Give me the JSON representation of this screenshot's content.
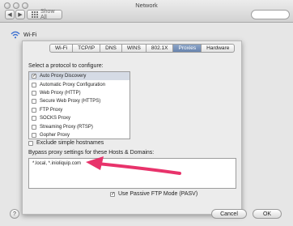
{
  "window": {
    "title": "Network",
    "show_all": "Show All",
    "back": "◀",
    "forward": "▶"
  },
  "network": {
    "service": "Wi-Fi"
  },
  "tabs": [
    {
      "label": "Wi-Fi",
      "active": false
    },
    {
      "label": "TCP/IP",
      "active": false
    },
    {
      "label": "DNS",
      "active": false
    },
    {
      "label": "WINS",
      "active": false
    },
    {
      "label": "802.1X",
      "active": false
    },
    {
      "label": "Proxies",
      "active": true
    },
    {
      "label": "Hardware",
      "active": false
    }
  ],
  "proxies": {
    "configure_label": "Select a protocol to configure:",
    "protocols": [
      {
        "label": "Auto Proxy Discovery",
        "checked": true,
        "selected": true
      },
      {
        "label": "Automatic Proxy Configuration",
        "checked": false,
        "selected": false
      },
      {
        "label": "Web Proxy (HTTP)",
        "checked": false,
        "selected": false
      },
      {
        "label": "Secure Web Proxy (HTTPS)",
        "checked": false,
        "selected": false
      },
      {
        "label": "FTP Proxy",
        "checked": false,
        "selected": false
      },
      {
        "label": "SOCKS Proxy",
        "checked": false,
        "selected": false
      },
      {
        "label": "Streaming Proxy (RTSP)",
        "checked": false,
        "selected": false
      },
      {
        "label": "Gopher Proxy",
        "checked": false,
        "selected": false
      }
    ],
    "exclude_simple_hostnames": {
      "label": "Exclude simple hostnames",
      "checked": false
    },
    "bypass_label": "Bypass proxy settings for these Hosts & Domains:",
    "bypass_value": "*.local, *.inioliquip.com",
    "passive_ftp": {
      "label": "Use Passive FTP Mode (PASV)",
      "checked": true
    }
  },
  "buttons": {
    "help": "?",
    "cancel": "Cancel",
    "ok": "OK"
  },
  "colors": {
    "annotation_arrow": "#e8336b",
    "selected_tab": "#6f8bb5"
  }
}
